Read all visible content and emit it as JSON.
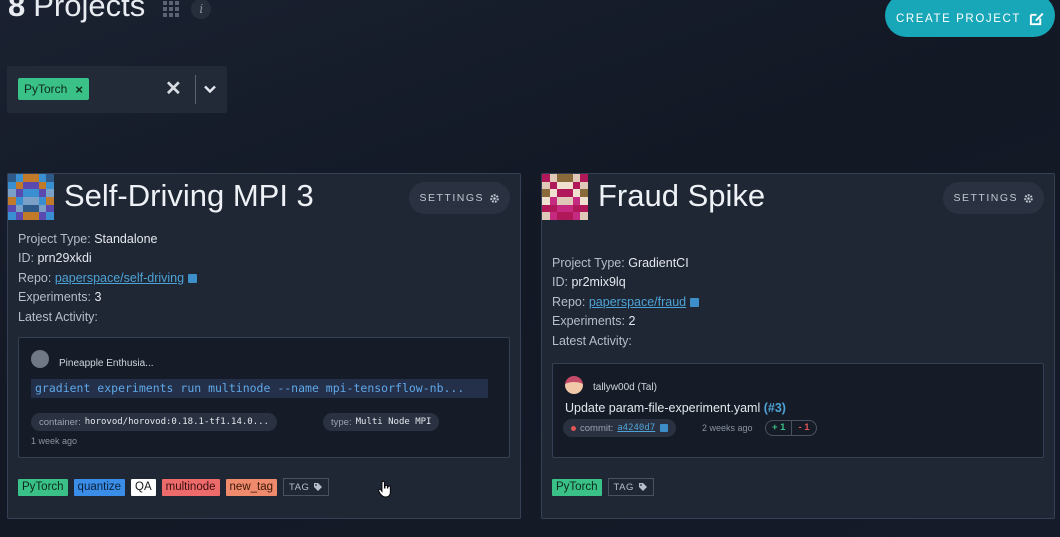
{
  "header": {
    "count": "8",
    "title": "Projects",
    "info": "i"
  },
  "create_button": {
    "label": "CREATE PROJECT"
  },
  "filter": {
    "chip": "PyTorch",
    "chip_remove": "×",
    "clear": "✕"
  },
  "projects": [
    {
      "title": "Self-Driving MPI 3",
      "settings": "SETTINGS",
      "project_type_label": "Project Type:",
      "project_type": "Standalone",
      "id_label": "ID:",
      "id": "prn29xkdi",
      "repo_label": "Repo:",
      "repo": "paperspace/self-driving",
      "experiments_label": "Experiments:",
      "experiments": "3",
      "latest_activity_label": "Latest Activity:",
      "activity": {
        "user": "Pineapple Enthusia...",
        "command": "gradient experiments run multinode --name mpi-tensorflow-nb...",
        "container_label": "container:",
        "container": "horovod/horovod:0.18.1-tf1.14.0...",
        "type_label": "type:",
        "type": "Multi Node MPI",
        "time": "1 week ago"
      },
      "tags": [
        {
          "label": "PyTorch",
          "color": "#39c187",
          "text_color": "#0f2a1c"
        },
        {
          "label": "quantize",
          "color": "#3b8ee8",
          "text_color": "#0b1f3a"
        },
        {
          "label": "QA",
          "color": "#ffffff",
          "text_color": "#1a1a1a"
        },
        {
          "label": "multinode",
          "color": "#ee6b6b",
          "text_color": "#3a0e0e"
        },
        {
          "label": "new_tag",
          "color": "#f08a6c",
          "text_color": "#3a1608"
        }
      ],
      "tag_button": "TAG"
    },
    {
      "title": "Fraud Spike",
      "settings": "SETTINGS",
      "project_type_label": "Project Type:",
      "project_type": "GradientCI",
      "id_label": "ID:",
      "id": "pr2mix9lq",
      "repo_label": "Repo:",
      "repo": "paperspace/fraud",
      "experiments_label": "Experiments:",
      "experiments": "2",
      "latest_activity_label": "Latest Activity:",
      "activity": {
        "user": "tallyw00d (Tal)",
        "message": "Update param-file-experiment.yaml",
        "pr": "(#3)",
        "commit_label": "commit:",
        "commit": "a4240d7",
        "time": "2 weeks ago",
        "additions": "+ 1",
        "deletions": "- 1"
      },
      "tags": [
        {
          "label": "PyTorch",
          "color": "#39c187",
          "text_color": "#0f2a1c"
        }
      ],
      "tag_button": "TAG"
    }
  ],
  "colors": {
    "accent": "#17a7b8",
    "link": "#4ea3d6",
    "card_bg": "#1f2634"
  }
}
